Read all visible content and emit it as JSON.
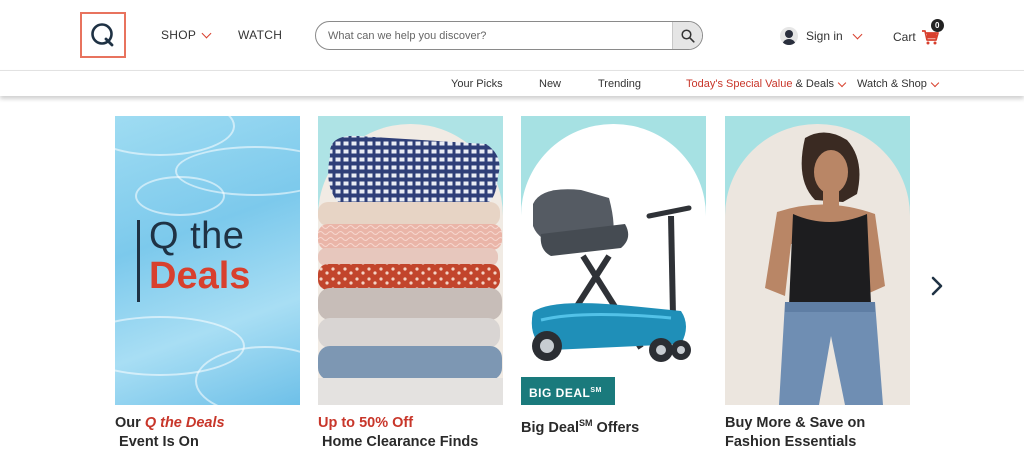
{
  "header": {
    "logo_letter": "Q",
    "nav": {
      "shop_label": "SHOP",
      "watch_label": "WATCH"
    },
    "search": {
      "placeholder": "What can we help you discover?"
    },
    "account": {
      "signin_label": "Sign in"
    },
    "cart": {
      "label": "Cart",
      "count": "0"
    }
  },
  "subnav": {
    "items": [
      {
        "label": "Your Picks"
      },
      {
        "label": "New"
      },
      {
        "label": "Trending"
      },
      {
        "label_red": "Today's Special Value",
        "label": " & Deals"
      },
      {
        "label": "Watch & Shop"
      }
    ]
  },
  "tiles": [
    {
      "image_text_line1": "Q the",
      "image_text_line2": "Deals",
      "caption_pre": "Our ",
      "caption_accent": "Q the Deals",
      "caption_post": " Event Is On"
    },
    {
      "caption_accent": "Up to 50% Off",
      "caption_post": " Home Clearance Finds"
    },
    {
      "badge": "BIG DEAL",
      "badge_sup": "SM",
      "caption_pre": "Big Deal",
      "caption_sup": "SM",
      "caption_post": " Offers"
    },
    {
      "caption_post": "Buy More & Save on Fashion Essentials"
    }
  ],
  "colors": {
    "accent": "#d8402e",
    "navy": "#1f3244",
    "teal_bg": "#a6e1e3",
    "badge_teal": "#1a7a7c",
    "logo_border": "#e8735e"
  },
  "icons": {
    "search": "search-icon",
    "user": "user-icon",
    "cart": "cart-icon",
    "next": "chevron-right-icon"
  }
}
